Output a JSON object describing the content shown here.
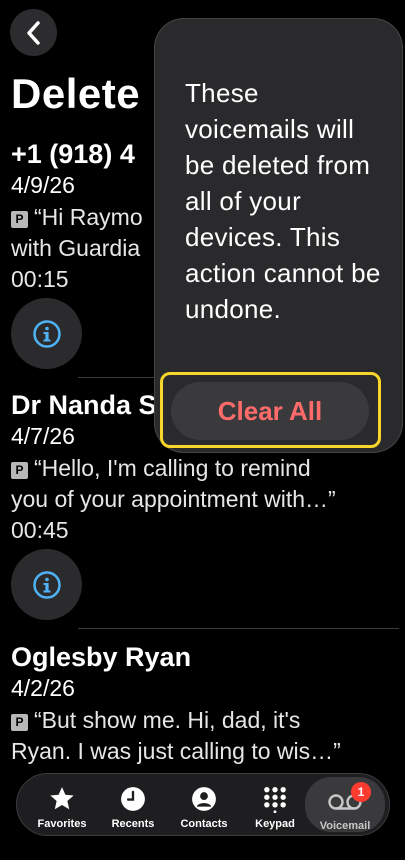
{
  "page": {
    "title": "Delete"
  },
  "voicemails": [
    {
      "caller": "+1 (918) 4",
      "date": "4/9/26",
      "line1": "“Hi Raymo",
      "line2": "with Guardia",
      "duration": "00:15"
    },
    {
      "caller": "Dr Nanda S",
      "date": "4/7/26",
      "line1": "“Hello, I'm calling to remind",
      "line2": "you of your appointment with…”",
      "duration": "00:45"
    },
    {
      "caller": "Oglesby Ryan",
      "date": "4/2/26",
      "line1": "“But show me.  Hi, dad, it's",
      "line2": "Ryan.  I was just calling to wis…”"
    }
  ],
  "transcript_badge": "P",
  "popover": {
    "message": "These voicemails will be deleted from all of your devices. This action cannot be undone.",
    "clear_all_label": "Clear All",
    "clear_all_color": "#ff6b6b",
    "highlight_color": "#f7d52a"
  },
  "tabbar": {
    "tabs": [
      {
        "label": "Favorites",
        "icon": "star-icon"
      },
      {
        "label": "Recents",
        "icon": "clock-icon"
      },
      {
        "label": "Contacts",
        "icon": "person-icon"
      },
      {
        "label": "Keypad",
        "icon": "keypad-icon"
      },
      {
        "label": "Voicemail",
        "icon": "voicemail-icon",
        "active": true,
        "badge": "1"
      }
    ]
  }
}
